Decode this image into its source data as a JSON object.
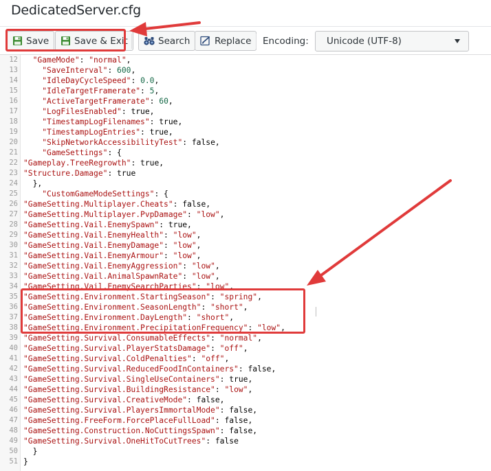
{
  "window": {
    "title": "DedicatedServer.cfg"
  },
  "toolbar": {
    "save_label": "Save",
    "save_exit_label": "Save & Exit",
    "search_label": "Search",
    "replace_label": "Replace",
    "encoding_label": "Encoding:",
    "encoding_value": "Unicode (UTF-8)"
  },
  "colors": {
    "annotation": "#e03a3a",
    "save_icon": "#3a8a2f",
    "key_string": "#aa1111",
    "number": "#116644"
  },
  "icons": {
    "save": "floppy-disk-icon",
    "save_exit": "floppy-disk-icon",
    "search": "binoculars-icon",
    "replace": "replace-icon",
    "encoding": "chevron-down-icon"
  },
  "editor": {
    "lines": [
      {
        "n": "12",
        "t": "  \"GameMode\": \"normal\","
      },
      {
        "n": "13",
        "t": "    \"SaveInterval\": 600,"
      },
      {
        "n": "14",
        "t": "    \"IdleDayCycleSpeed\": 0.0,"
      },
      {
        "n": "15",
        "t": "    \"IdleTargetFramerate\": 5,"
      },
      {
        "n": "16",
        "t": "    \"ActiveTargetFramerate\": 60,"
      },
      {
        "n": "17",
        "t": "    \"LogFilesEnabled\": true,"
      },
      {
        "n": "18",
        "t": "    \"TimestampLogFilenames\": true,"
      },
      {
        "n": "19",
        "t": "    \"TimestampLogEntries\": true,"
      },
      {
        "n": "20",
        "t": "    \"SkipNetworkAccessibilityTest\": false,"
      },
      {
        "n": "21",
        "t": "    \"GameSettings\": {"
      },
      {
        "n": "22",
        "t": "\"Gameplay.TreeRegrowth\": true,"
      },
      {
        "n": "23",
        "t": "\"Structure.Damage\": true"
      },
      {
        "n": "24",
        "t": "  },"
      },
      {
        "n": "25",
        "t": "    \"CustomGameModeSettings\": {"
      },
      {
        "n": "26",
        "t": "\"GameSetting.Multiplayer.Cheats\": false,"
      },
      {
        "n": "27",
        "t": "\"GameSetting.Multiplayer.PvpDamage\": \"low\","
      },
      {
        "n": "28",
        "t": "\"GameSetting.Vail.EnemySpawn\": true,"
      },
      {
        "n": "29",
        "t": "\"GameSetting.Vail.EnemyHealth\": \"low\","
      },
      {
        "n": "30",
        "t": "\"GameSetting.Vail.EnemyDamage\": \"low\","
      },
      {
        "n": "31",
        "t": "\"GameSetting.Vail.EnemyArmour\": \"low\","
      },
      {
        "n": "32",
        "t": "\"GameSetting.Vail.EnemyAggression\": \"low\","
      },
      {
        "n": "33",
        "t": "\"GameSetting.Vail.AnimalSpawnRate\": \"low\","
      },
      {
        "n": "34",
        "t": "\"GameSetting.Vail.EnemySearchParties\": \"low\","
      },
      {
        "n": "35",
        "t": "\"GameSetting.Environment.StartingSeason\": \"spring\","
      },
      {
        "n": "36",
        "t": "\"GameSetting.Environment.SeasonLength\": \"short\","
      },
      {
        "n": "37",
        "t": "\"GameSetting.Environment.DayLength\": \"short\","
      },
      {
        "n": "38",
        "t": "\"GameSetting.Environment.PrecipitationFrequency\": \"low\","
      },
      {
        "n": "39",
        "t": "\"GameSetting.Survival.ConsumableEffects\": \"normal\","
      },
      {
        "n": "40",
        "t": "\"GameSetting.Survival.PlayerStatsDamage\": \"off\","
      },
      {
        "n": "41",
        "t": "\"GameSetting.Survival.ColdPenalties\": \"off\","
      },
      {
        "n": "42",
        "t": "\"GameSetting.Survival.ReducedFoodInContainers\": false,"
      },
      {
        "n": "43",
        "t": "\"GameSetting.Survival.SingleUseContainers\": true,"
      },
      {
        "n": "44",
        "t": "\"GameSetting.Survival.BuildingResistance\": \"low\","
      },
      {
        "n": "45",
        "t": "\"GameSetting.Survival.CreativeMode\": false,"
      },
      {
        "n": "46",
        "t": "\"GameSetting.Survival.PlayersImmortalMode\": false,"
      },
      {
        "n": "47",
        "t": "\"GameSetting.FreeForm.ForcePlaceFullLoad\": false,"
      },
      {
        "n": "48",
        "t": "\"GameSetting.Construction.NoCuttingsSpawn\": false,"
      },
      {
        "n": "49",
        "t": "\"GameSetting.Survival.OneHitToCutTrees\": false"
      },
      {
        "n": "50",
        "t": "  }"
      },
      {
        "n": "51",
        "t": "}"
      }
    ]
  }
}
